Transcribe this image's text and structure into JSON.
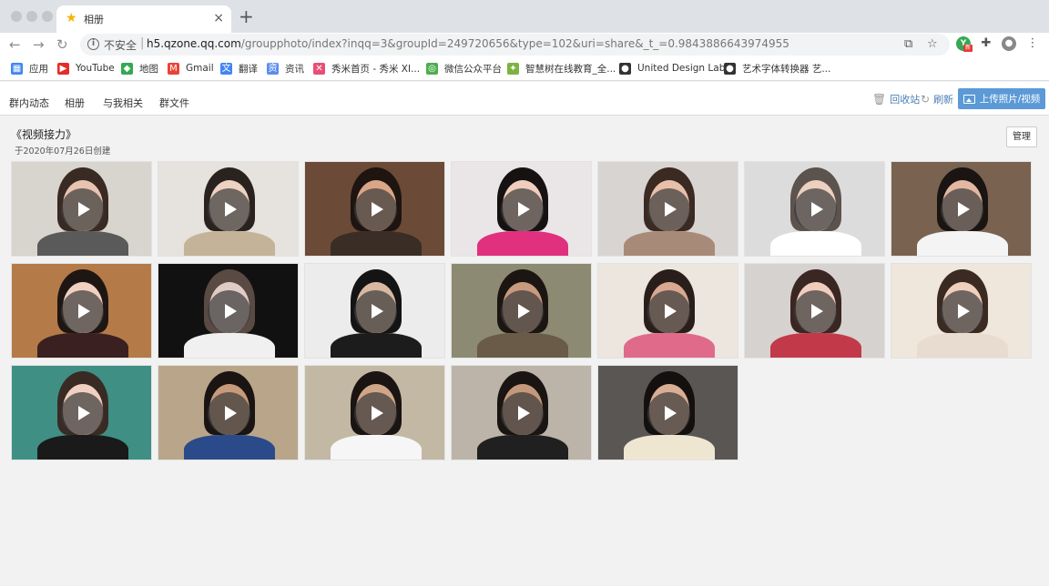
{
  "browser": {
    "tab_title": "相册",
    "insecure_label": "不安全",
    "url_host": "h5.qzone.qq.com",
    "url_path": "/groupphoto/index?inqq=3&groupId=249720656&type=102&uri=share&_t_=0.9843886643974955",
    "bookmarks": [
      {
        "label": "应用",
        "icon": "apps-grid-icon",
        "color": "#4285f4"
      },
      {
        "label": "YouTube",
        "icon": "youtube-icon",
        "color": "#e52d27"
      },
      {
        "label": "地图",
        "icon": "maps-icon",
        "color": "#34a853"
      },
      {
        "label": "Gmail",
        "icon": "gmail-icon",
        "color": "#ea4335"
      },
      {
        "label": "翻译",
        "icon": "translate-icon",
        "color": "#4285f4"
      },
      {
        "label": "资讯",
        "icon": "news-icon",
        "color": "#5b8def"
      },
      {
        "label": "秀米首页 - 秀米 XI...",
        "icon": "xiumi-icon",
        "color": "#e94e77"
      },
      {
        "label": "微信公众平台",
        "icon": "wechat-icon",
        "color": "#4cae4f"
      },
      {
        "label": "智慧树在线教育_全...",
        "icon": "zhihuishu-icon",
        "color": "#7cb342"
      },
      {
        "label": "United Design Lab",
        "icon": "globe-icon",
        "color": "#333333"
      },
      {
        "label": "艺术字体转换器 艺...",
        "icon": "globe-icon",
        "color": "#333333"
      }
    ]
  },
  "nav": {
    "items": [
      "群内动态",
      "相册",
      "与我相关",
      "群文件"
    ],
    "recycle": "回收站",
    "refresh": "刷新",
    "upload": "上传照片/视频"
  },
  "album": {
    "title": "《视频接力》",
    "created": "于2020年07月26日创建",
    "manage": "管理"
  },
  "videos": [
    {
      "bg": "#d8d4ce",
      "skin": "#e8c4b0",
      "hair": "#3a2a24",
      "shirt": "#5a5a5a"
    },
    {
      "bg": "#e6e2dd",
      "skin": "#edd2c2",
      "hair": "#2a221e",
      "shirt": "#c4b398"
    },
    {
      "bg": "#6b4a38",
      "skin": "#d9a688",
      "hair": "#1e1410",
      "shirt": "#3a2d26"
    },
    {
      "bg": "#eae6e8",
      "skin": "#f0cdbd",
      "hair": "#161212",
      "shirt": "#e0307e"
    },
    {
      "bg": "#d8d4d2",
      "skin": "#e8c0aa",
      "hair": "#3b2a22",
      "shirt": "#a88a78"
    },
    {
      "bg": "#dcdcdc",
      "skin": "#ecd0c0",
      "hair": "#5c534e",
      "shirt": "#ffffff"
    },
    {
      "bg": "#7a6250",
      "skin": "#e2b8a0",
      "hair": "#1a1412",
      "shirt": "#f4f4f4"
    },
    {
      "bg": "#b47a48",
      "skin": "#f2d0c0",
      "hair": "#1e1612",
      "shirt": "#3a2020"
    },
    {
      "bg": "#111111",
      "skin": "#e0ccc4",
      "hair": "#5a4a44",
      "shirt": "#f0f0f0"
    },
    {
      "bg": "#ececec",
      "skin": "#d8b8a0",
      "hair": "#141414",
      "shirt": "#1c1c1c"
    },
    {
      "bg": "#8c8a72",
      "skin": "#c89a7e",
      "hair": "#1c1612",
      "shirt": "#6a5a48"
    },
    {
      "bg": "#ece6df",
      "skin": "#d8a890",
      "hair": "#2a1e1a",
      "shirt": "#e06a8a"
    },
    {
      "bg": "#d6d2d0",
      "skin": "#f0cdbd",
      "hair": "#3a2622",
      "shirt": "#c23a4a"
    },
    {
      "bg": "#efe6dc",
      "skin": "#f0cfbd",
      "hair": "#3a2a22",
      "shirt": "#e8dcd0"
    },
    {
      "bg": "#3f8f84",
      "skin": "#f0d0c0",
      "hair": "#3a2a24",
      "shirt": "#1a1a1a"
    },
    {
      "bg": "#b9a68a",
      "skin": "#c79a7c",
      "hair": "#1a1412",
      "shirt": "#2a4a8a"
    },
    {
      "bg": "#c2b8a4",
      "skin": "#d0a688",
      "hair": "#1a1412",
      "shirt": "#f6f6f6"
    },
    {
      "bg": "#bcb4a8",
      "skin": "#c4987a",
      "hair": "#1a1412",
      "shirt": "#202020"
    },
    {
      "bg": "#5a5654",
      "skin": "#d8ae94",
      "hair": "#141010",
      "shirt": "#efe6d2"
    }
  ]
}
